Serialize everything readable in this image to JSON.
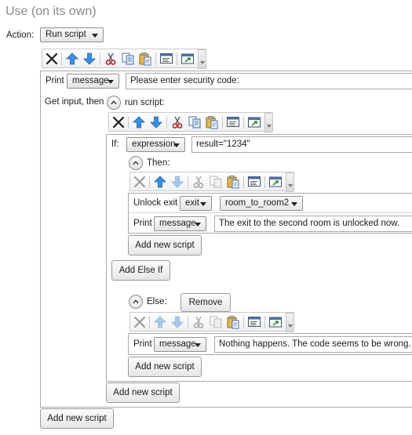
{
  "header": {
    "title": "Use (on its own)"
  },
  "action": {
    "label": "Action:",
    "value": "Run script"
  },
  "outer": {
    "print": {
      "label": "Print",
      "type": "message",
      "text": "Please enter security code:"
    },
    "get_input": {
      "label": "Get input, then",
      "run_script_label": "run script:"
    },
    "add_script_label": "Add new script"
  },
  "inner": {
    "if_row": {
      "label": "If:",
      "type": "expression",
      "value": "result=\"1234\""
    },
    "then_label": "Then:",
    "unlock": {
      "label": "Unlock exit",
      "type": "exit",
      "value": "room_to_room2"
    },
    "then_print": {
      "label": "Print",
      "type": "message",
      "text": "The exit to the second room is unlocked now."
    },
    "then_add_label": "Add new script",
    "add_else_if_label": "Add Else If",
    "else_label": "Else:",
    "remove_label": "Remove",
    "else_print": {
      "label": "Print",
      "type": "message",
      "text": "Nothing happens. The code seems to be wrong."
    },
    "else_add_label": "Add new script",
    "add_script_label": "Add new script"
  },
  "icons": {
    "toolbar": [
      "delete-icon",
      "move-up-icon",
      "move-down-icon",
      "cut-icon",
      "copy-icon",
      "paste-icon",
      "code-view-icon",
      "pop-out-icon",
      "more-options-icon"
    ],
    "collapse": "collapse-icon",
    "colors": {
      "arrow_blue": "#3a8ee6",
      "cut_red": "#c02525",
      "paper_yellow": "#e6b84a",
      "disabled": "#b8b8b8"
    }
  }
}
